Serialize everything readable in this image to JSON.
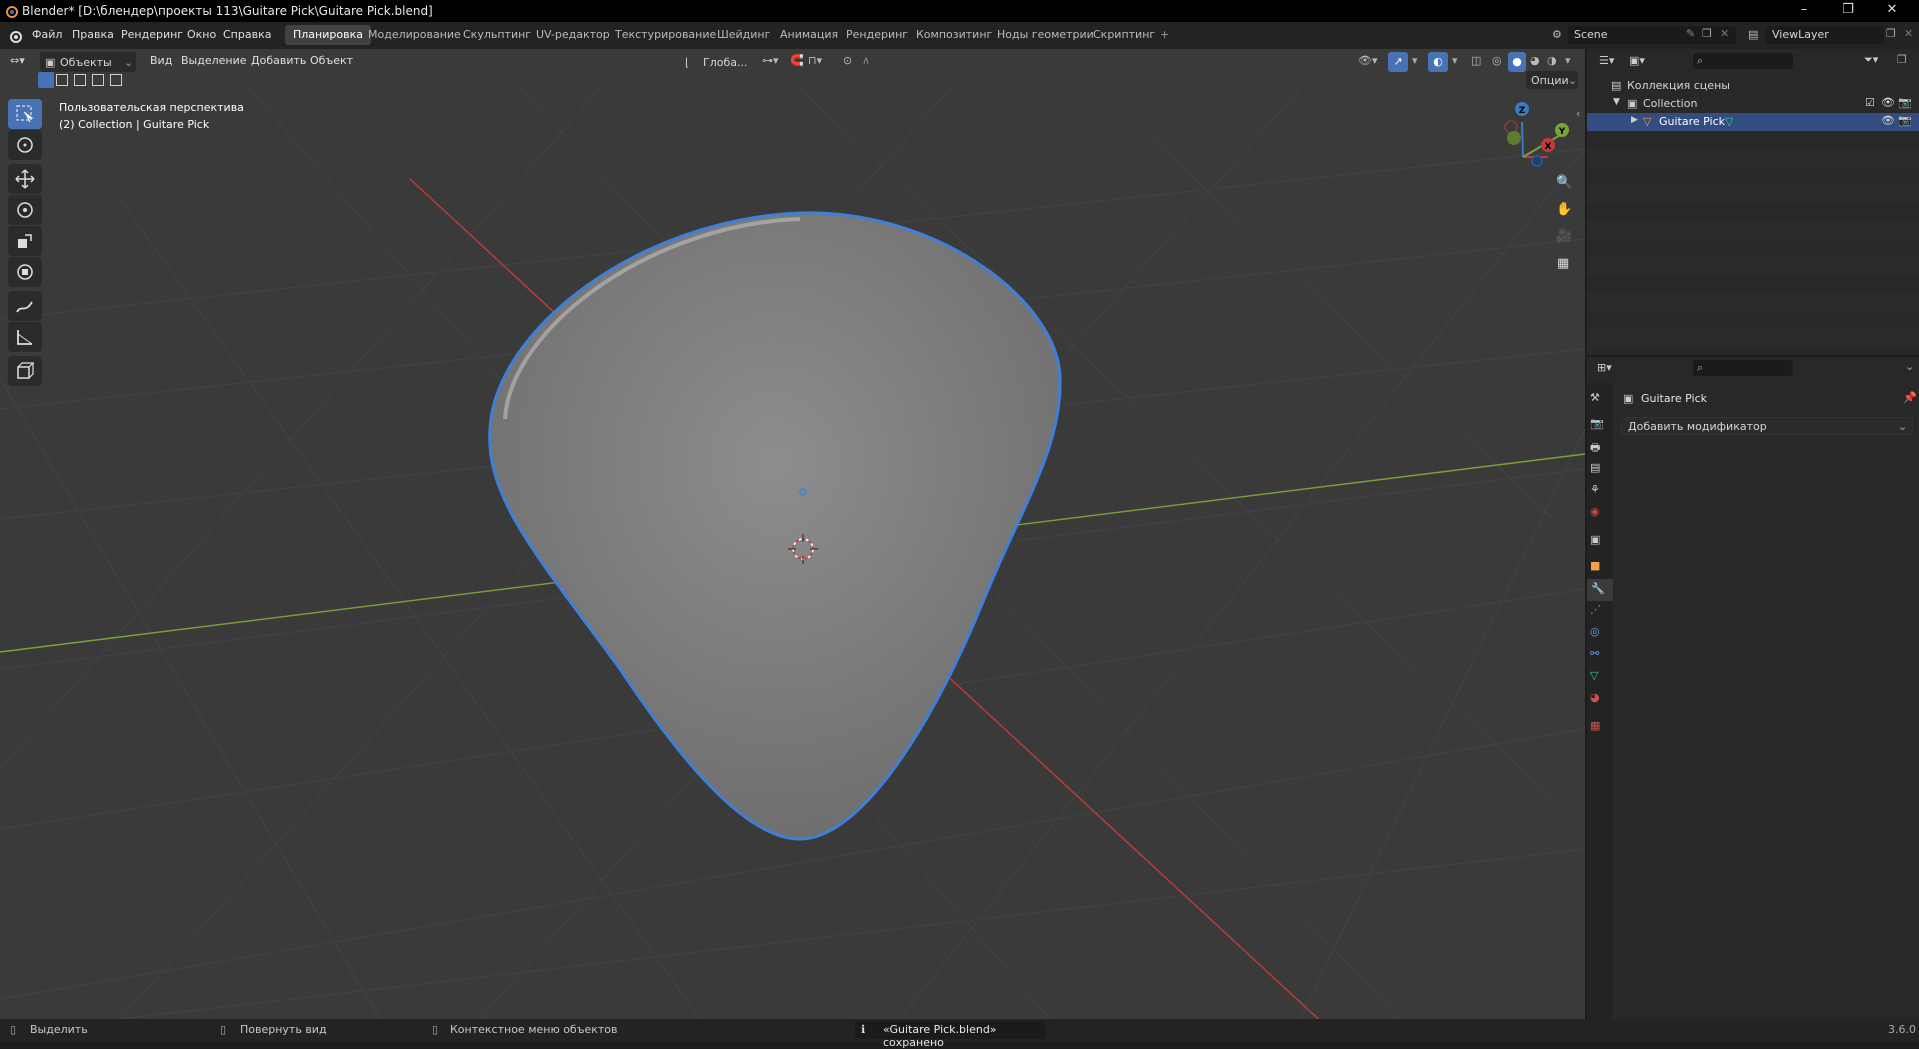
{
  "window": {
    "title": "Blender* [D:\\блендер\\проекты 113\\Guitare Pick\\Guitare Pick.blend]",
    "minimize": "–",
    "maximize": "❐",
    "close": "✕"
  },
  "menu": [
    "Файл",
    "Правка",
    "Рендеринг",
    "Окно",
    "Справка"
  ],
  "workspaces": [
    "Планировка",
    "Моделирование",
    "Скульптинг",
    "UV-редактор",
    "Текстурирование",
    "Шейдинг",
    "Анимация",
    "Рендеринг",
    "Композитинг",
    "Ноды геометрии",
    "Скриптинг",
    "+"
  ],
  "active_workspace": "Планировка",
  "scene": {
    "name": "Scene",
    "view_layer": "ViewLayer"
  },
  "viewport": {
    "mode": "Объекты",
    "menus": [
      "Вид",
      "Выделение",
      "Добавить",
      "Объект"
    ],
    "transform_orientation": "Глоба...",
    "options": "Опции",
    "overlay_line1": "Пользовательская перспектива",
    "overlay_line2": "(2) Collection | Guitare Pick",
    "gizmo": {
      "x": "X",
      "y": "Y",
      "z": "Z"
    }
  },
  "tools": [
    "select-box",
    "cursor",
    "move",
    "rotate",
    "scale",
    "transform",
    "annotate",
    "measure",
    "add-cube"
  ],
  "outliner": {
    "root": "Коллекция сцены",
    "collection": "Collection",
    "object": "Guitare Pick"
  },
  "properties": {
    "object_name": "Guitare Pick",
    "add_modifier": "Добавить модификатор"
  },
  "statusbar": {
    "select": "Выделить",
    "rotate_view": "Повернуть вид",
    "context_menu": "Контекстное меню объектов",
    "message": "«Guitare Pick.blend» сохранено",
    "version": "3.6.0"
  },
  "colors": {
    "accent": "#4772b3",
    "x_axis": "#c43a3a",
    "y_axis": "#7aa33c",
    "z_axis": "#3c7ac4",
    "selection_outline": "#3f7fd6"
  }
}
